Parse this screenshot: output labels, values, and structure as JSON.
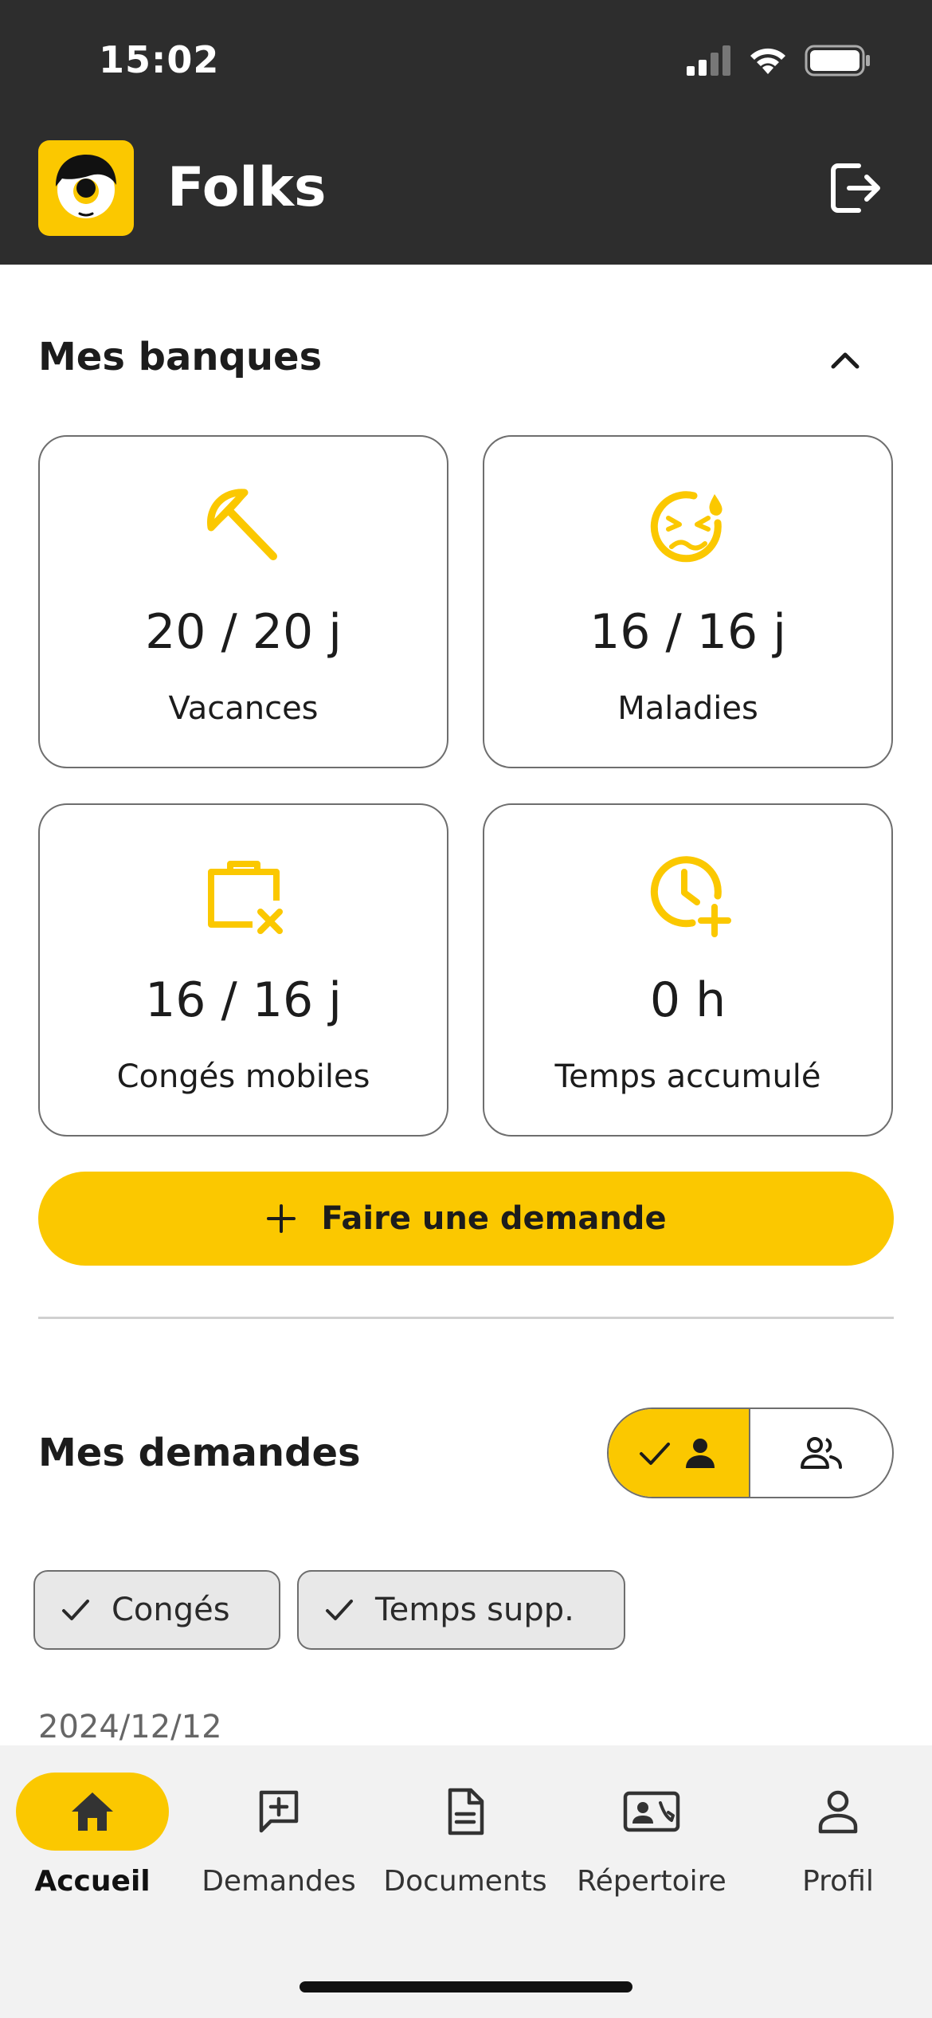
{
  "status_bar": {
    "time": "15:02"
  },
  "app": {
    "title": "Folks"
  },
  "banks": {
    "title": "Mes banques",
    "cards": [
      {
        "value": "20 / 20 j",
        "label": "Vacances"
      },
      {
        "value": "16 / 16 j",
        "label": "Maladies"
      },
      {
        "value": "16 / 16 j",
        "label": "Congés mobiles"
      },
      {
        "value": "0 h",
        "label": "Temps accumulé"
      }
    ],
    "request_button": "Faire une demande"
  },
  "requests": {
    "title": "Mes demandes",
    "chips": [
      {
        "label": "Congés"
      },
      {
        "label": "Temps supp."
      }
    ],
    "first_date": "2024/12/12"
  },
  "nav": {
    "items": [
      {
        "label": "Accueil",
        "icon": "home-icon"
      },
      {
        "label": "Demandes",
        "icon": "add-comment-icon"
      },
      {
        "label": "Documents",
        "icon": "document-icon"
      },
      {
        "label": "Répertoire",
        "icon": "contact-card-icon"
      },
      {
        "label": "Profil",
        "icon": "person-icon"
      }
    ]
  },
  "colors": {
    "accent": "#fbc800",
    "header": "#2d2d2d",
    "nav_bg": "#f2f2f2"
  }
}
